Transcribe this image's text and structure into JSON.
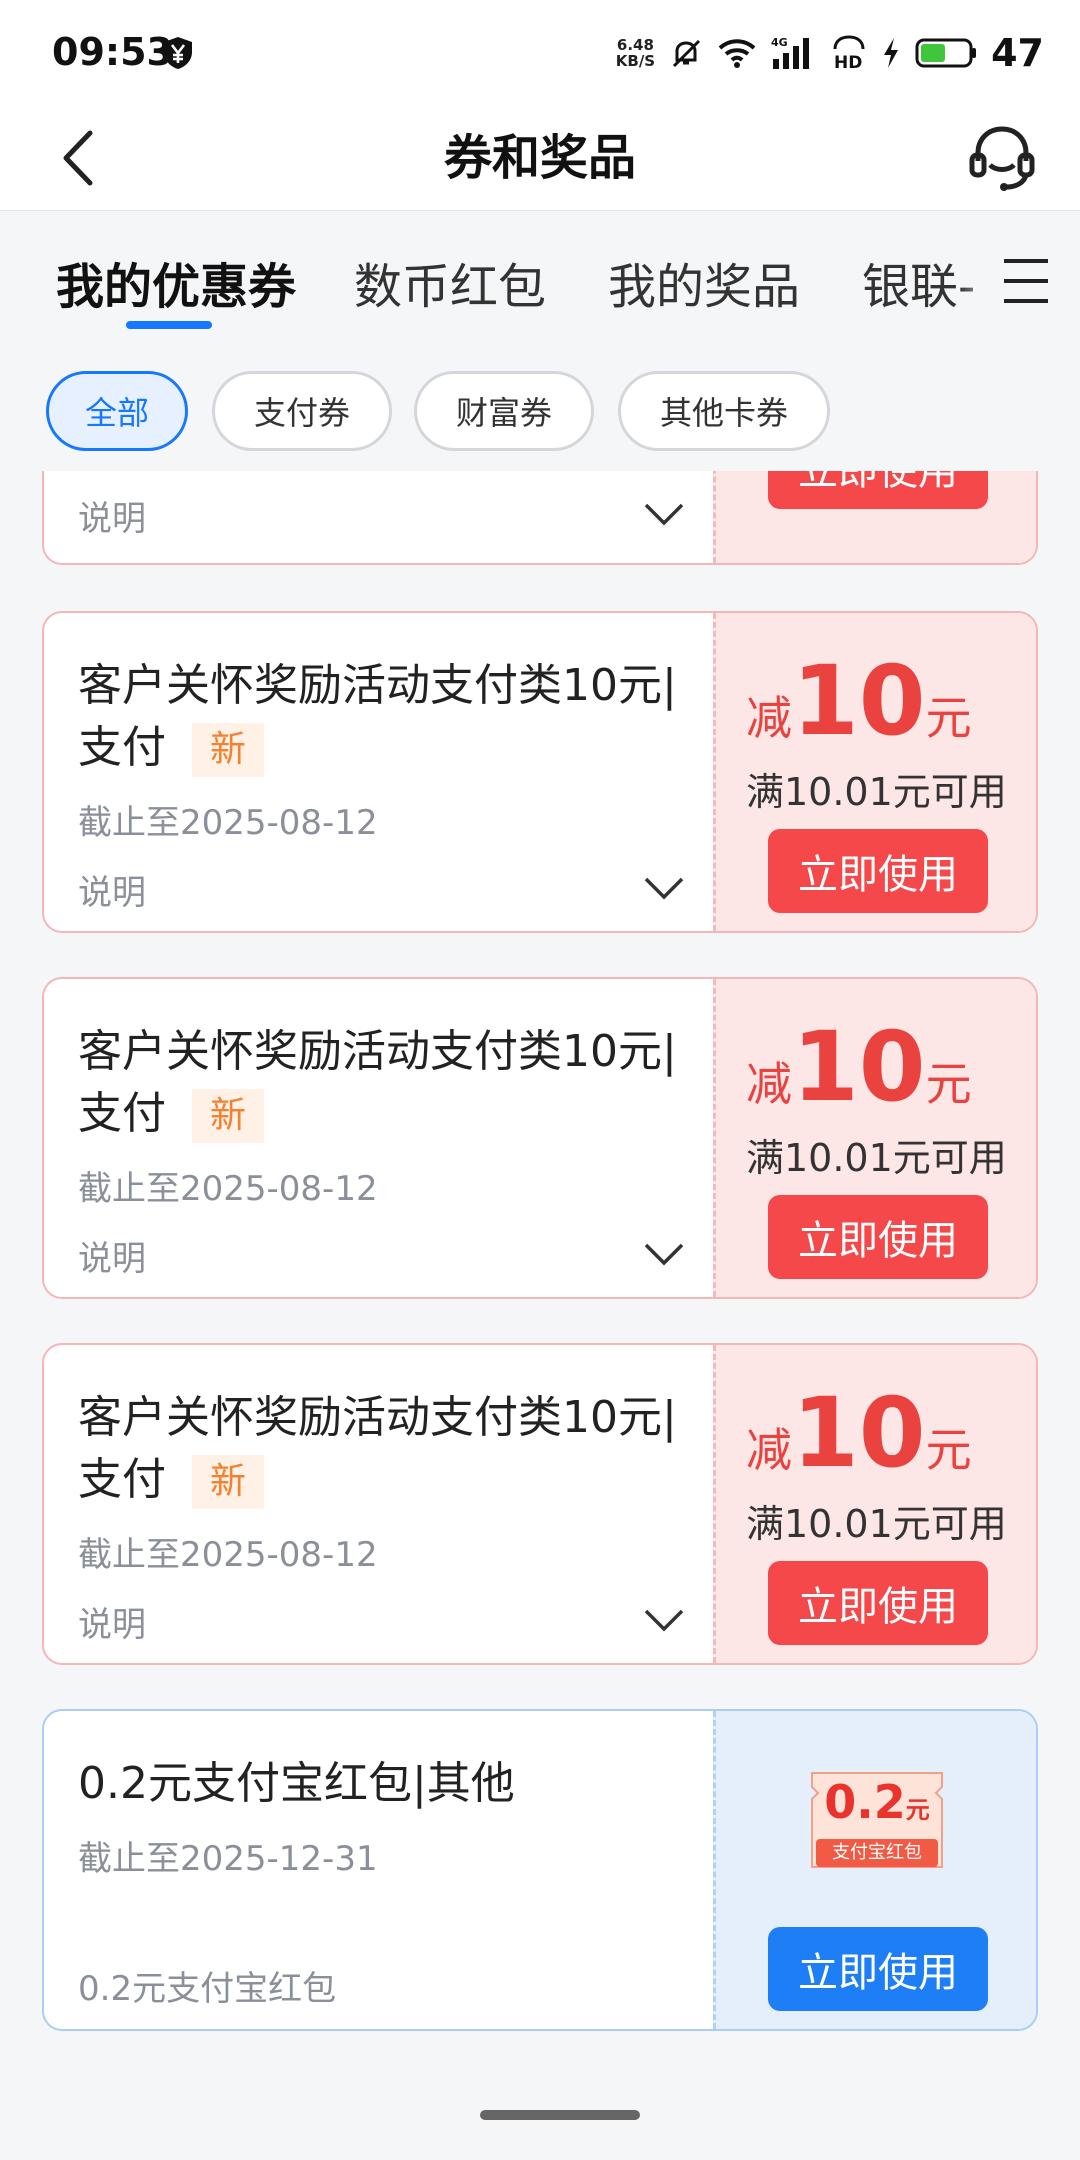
{
  "status_bar": {
    "time": "09:53",
    "net_speed_value": "6.48",
    "net_speed_unit": "KB/S",
    "battery": "47"
  },
  "header": {
    "title": "券和奖品"
  },
  "tabs": [
    "我的优惠券",
    "数币红包",
    "我的奖品",
    "银联-"
  ],
  "chips": [
    "全部",
    "支付券",
    "财富券",
    "其他卡券"
  ],
  "partial_card": {
    "desc_label": "说明",
    "button": "立即使用"
  },
  "coupons": [
    {
      "title": "客户关怀奖励活动支付类10元|支付",
      "badge": "新",
      "expiry": "截止至2025-08-12",
      "desc_label": "说明",
      "amount_prefix": "减",
      "amount": "10",
      "amount_unit": "元",
      "condition": "满10.01元可用",
      "button": "立即使用"
    },
    {
      "title": "客户关怀奖励活动支付类10元|支付",
      "badge": "新",
      "expiry": "截止至2025-08-12",
      "desc_label": "说明",
      "amount_prefix": "减",
      "amount": "10",
      "amount_unit": "元",
      "condition": "满10.01元可用",
      "button": "立即使用"
    },
    {
      "title": "客户关怀奖励活动支付类10元|支付",
      "badge": "新",
      "expiry": "截止至2025-08-12",
      "desc_label": "说明",
      "amount_prefix": "减",
      "amount": "10",
      "amount_unit": "元",
      "condition": "满10.01元可用",
      "button": "立即使用"
    }
  ],
  "red_packet": {
    "title": "0.2元支付宝红包|其他",
    "expiry": "截止至2025-12-31",
    "desc": "0.2元支付宝红包",
    "image_amount": "0.2",
    "image_unit": "元",
    "image_caption": "支付宝红包",
    "button": "立即使用"
  },
  "colors": {
    "accent_blue": "#1677ff",
    "coupon_red": "#f4484a",
    "badge_orange": "#f5812f"
  }
}
